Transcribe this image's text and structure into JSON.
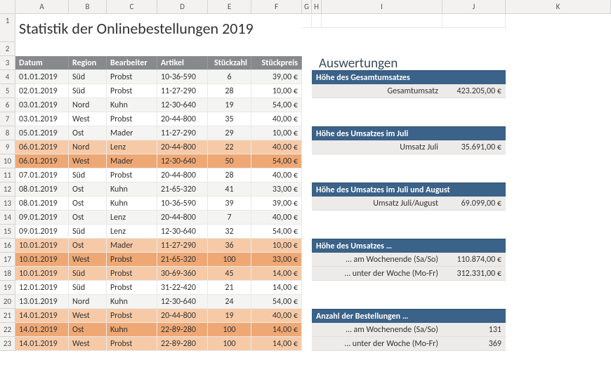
{
  "columns": [
    "A",
    "B",
    "C",
    "D",
    "E",
    "F",
    "G",
    "H",
    "I",
    "J",
    "K"
  ],
  "title": "Statistik der Onlinebestellungen 2019",
  "table": {
    "headers": [
      "Datum",
      "Region",
      "Bearbeiter",
      "Artikel",
      "Stückzahl",
      "Stückpreis"
    ],
    "rows": [
      {
        "d": "01.01.2019",
        "r": "Süd",
        "b": "Probst",
        "a": "10-36-590",
        "s": "6",
        "p": "39,00 €",
        "we": false
      },
      {
        "d": "02.01.2019",
        "r": "Süd",
        "b": "Probst",
        "a": "11-27-290",
        "s": "28",
        "p": "10,00 €",
        "we": false
      },
      {
        "d": "03.01.2019",
        "r": "Nord",
        "b": "Kuhn",
        "a": "12-30-640",
        "s": "19",
        "p": "54,00 €",
        "we": false
      },
      {
        "d": "03.01.2019",
        "r": "West",
        "b": "Probst",
        "a": "20-44-800",
        "s": "35",
        "p": "40,00 €",
        "we": false
      },
      {
        "d": "05.01.2019",
        "r": "Ost",
        "b": "Mader",
        "a": "11-27-290",
        "s": "29",
        "p": "10,00 €",
        "we": false
      },
      {
        "d": "06.01.2019",
        "r": "Nord",
        "b": "Lenz",
        "a": "20-44-800",
        "s": "22",
        "p": "40,00 €",
        "we": true
      },
      {
        "d": "06.01.2019",
        "r": "West",
        "b": "Mader",
        "a": "12-30-640",
        "s": "50",
        "p": "54,00 €",
        "we": true,
        "dark": true
      },
      {
        "d": "07.01.2019",
        "r": "Süd",
        "b": "Probst",
        "a": "20-44-800",
        "s": "28",
        "p": "40,00 €",
        "we": false
      },
      {
        "d": "08.01.2019",
        "r": "Ost",
        "b": "Kuhn",
        "a": "21-65-320",
        "s": "41",
        "p": "33,00 €",
        "we": false
      },
      {
        "d": "08.01.2019",
        "r": "Ost",
        "b": "Kuhn",
        "a": "10-36-590",
        "s": "39",
        "p": "39,00 €",
        "we": false
      },
      {
        "d": "09.01.2019",
        "r": "Ost",
        "b": "Lenz",
        "a": "20-44-800",
        "s": "7",
        "p": "40,00 €",
        "we": false
      },
      {
        "d": "09.01.2019",
        "r": "Süd",
        "b": "Lenz",
        "a": "12-30-640",
        "s": "32",
        "p": "54,00 €",
        "we": false
      },
      {
        "d": "10.01.2019",
        "r": "Ost",
        "b": "Mader",
        "a": "11-27-290",
        "s": "36",
        "p": "10,00 €",
        "we": true
      },
      {
        "d": "10.01.2019",
        "r": "West",
        "b": "Probst",
        "a": "21-65-320",
        "s": "100",
        "p": "33,00 €",
        "we": true,
        "dark": true
      },
      {
        "d": "10.01.2019",
        "r": "Süd",
        "b": "Probst",
        "a": "30-69-360",
        "s": "45",
        "p": "14,00 €",
        "we": true
      },
      {
        "d": "12.01.2019",
        "r": "Süd",
        "b": "Probst",
        "a": "31-22-420",
        "s": "21",
        "p": "14,00 €",
        "we": false
      },
      {
        "d": "13.01.2019",
        "r": "Nord",
        "b": "Kuhn",
        "a": "12-30-640",
        "s": "24",
        "p": "54,00 €",
        "we": false
      },
      {
        "d": "14.01.2019",
        "r": "West",
        "b": "Probst",
        "a": "20-44-800",
        "s": "19",
        "p": "40,00 €",
        "we": true
      },
      {
        "d": "14.01.2019",
        "r": "Ost",
        "b": "Kuhn",
        "a": "22-89-280",
        "s": "100",
        "p": "14,00 €",
        "we": true,
        "dark": true
      },
      {
        "d": "14.01.2019",
        "r": "West",
        "b": "Probst",
        "a": "22-89-280",
        "s": "100",
        "p": "14,00 €",
        "we": true
      }
    ]
  },
  "eval": {
    "title": "Auswertungen",
    "groups": [
      {
        "hdr": "Höhe des Gesamtumsatzes",
        "rows": [
          {
            "l": "Gesamtumsatz",
            "v": "423.205,00 €"
          }
        ]
      },
      {
        "hdr": "Höhe des Umsatzes im Juli",
        "rows": [
          {
            "l": "Umsatz Juli",
            "v": "35.691,00 €"
          }
        ]
      },
      {
        "hdr": "Höhe des Umsatzes im Juli und August",
        "rows": [
          {
            "l": "Umsatz Juli/August",
            "v": "69.099,00 €"
          }
        ]
      },
      {
        "hdr": "Höhe des Umsatzes …",
        "rows": [
          {
            "l": "… am Wochenende (Sa/So)",
            "v": "110.874,00 €"
          },
          {
            "l": "… unter der Woche (Mo-Fr)",
            "v": "312.331,00 €"
          }
        ]
      },
      {
        "hdr": "Anzahl der Bestellungen …",
        "rows": [
          {
            "l": "… am Wochenende (Sa/So)",
            "v": "131"
          },
          {
            "l": "… unter der Woche (Mo-Fr)",
            "v": "369"
          }
        ]
      }
    ]
  }
}
